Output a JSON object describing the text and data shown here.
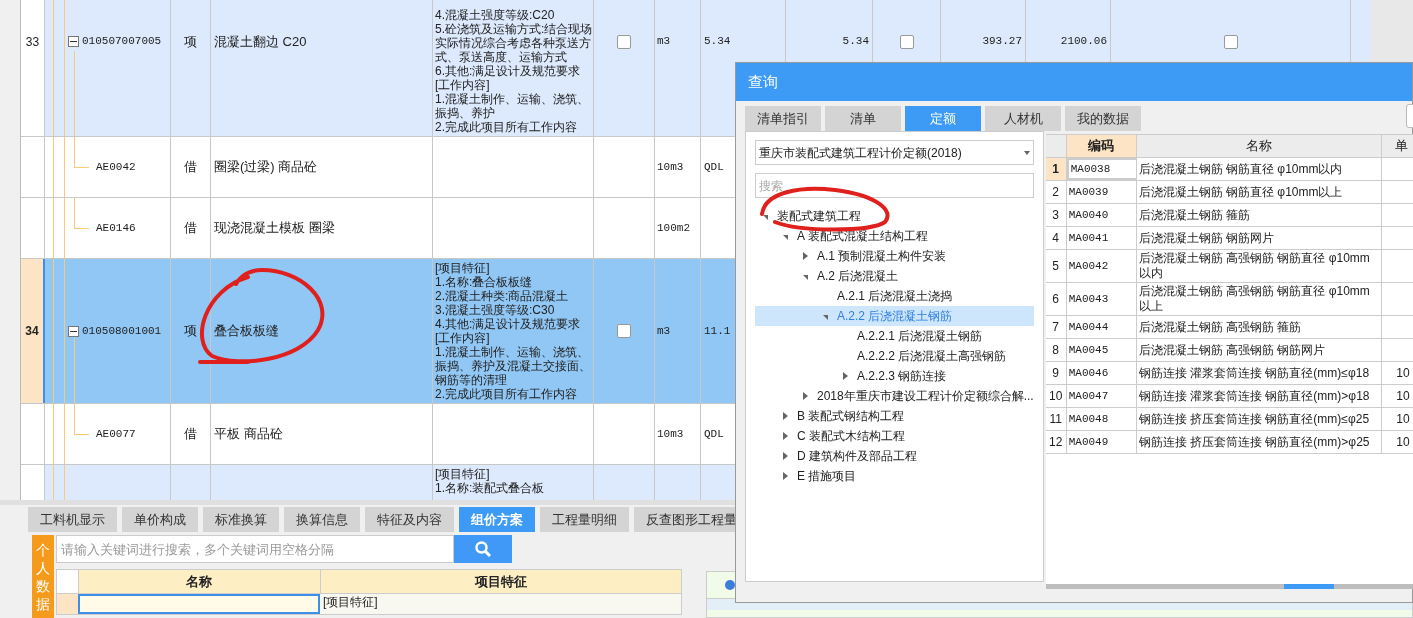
{
  "main_table": {
    "rows": [
      {
        "kind": "item",
        "number": "33",
        "expanded": true,
        "code": "010507007005",
        "type": "项",
        "name": "混凝土翻边 C20",
        "features": [
          "4.混凝土强度等级:C20",
          "5.砼浇筑及运输方式:结合现场实际情况综合考虑各种泵送方式、泵送高度、运输方式",
          "6.其他:满足设计及规范要求",
          "[工作内容]",
          "1.混凝土制作、运输、浇筑、振捣、养护",
          "2.完成此项目所有工作内容"
        ],
        "checked": false,
        "unit": "m3",
        "quantity": "5.34",
        "column_9": "5.34",
        "column_10_checked": false,
        "column_11": "393.27",
        "column_12": "2100.06",
        "column_13_checked": false,
        "selected": false
      },
      {
        "kind": "sub",
        "code": "AE0042",
        "type": "借",
        "name": "圈梁(过梁) 商品砼",
        "unit": "10m3",
        "quantity": "QDL",
        "selected": false
      },
      {
        "kind": "sub",
        "code": "AE0146",
        "type": "借",
        "name": "现浇混凝土模板 圈梁",
        "unit": "100m2",
        "selected": false
      },
      {
        "kind": "item",
        "number": "34",
        "expanded": true,
        "code": "010508001001",
        "type": "项",
        "name": "叠合板板缝",
        "features": [
          "[项目特征]",
          "1.名称:叠合板板缝",
          "2.混凝土种类:商品混凝土",
          "3.混凝土强度等级:C30",
          "4.其他:满足设计及规范要求",
          "[工作内容]",
          "1.混凝土制作、运输、浇筑、振捣、养护及混凝土交接面、钢筋等的清理",
          "2.完成此项目所有工作内容"
        ],
        "checked": false,
        "unit": "m3",
        "quantity": "11.1",
        "selected": true
      },
      {
        "kind": "sub",
        "code": "AE0077",
        "type": "借",
        "name": "平板 商品砼",
        "unit": "10m3",
        "quantity": "QDL",
        "selected": false
      },
      {
        "kind": "item_partial",
        "features": [
          "[项目特征]",
          "1.名称:装配式叠合板"
        ],
        "selected": false
      }
    ]
  },
  "detail_tabs": [
    {
      "label": "工料机显示",
      "selected": false
    },
    {
      "label": "单价构成",
      "selected": false
    },
    {
      "label": "标准换算",
      "selected": false
    },
    {
      "label": "换算信息",
      "selected": false
    },
    {
      "label": "特征及内容",
      "selected": false
    },
    {
      "label": "组价方案",
      "selected": true
    },
    {
      "label": "工程量明细",
      "selected": false
    },
    {
      "label": "反查图形工程量",
      "selected": false
    }
  ],
  "side_tab": "个人数据",
  "plan_search": {
    "placeholder": "请输入关键词进行搜索，多个关键词用空格分隔"
  },
  "plan_table": {
    "columns": [
      "名称",
      "项目特征"
    ],
    "rows": [
      {
        "column_2": "[项目特征]"
      }
    ]
  },
  "dialog": {
    "title": "查询",
    "tabs": [
      {
        "label": "清单指引",
        "selected": false
      },
      {
        "label": "清单",
        "selected": false
      },
      {
        "label": "定额",
        "selected": true
      },
      {
        "label": "人材机",
        "selected": false
      },
      {
        "label": "我的数据",
        "selected": false
      }
    ],
    "library_select": {
      "value": "重庆市装配式建筑工程计价定额(2018)"
    },
    "search": {
      "placeholder": "搜索"
    },
    "tree": [
      {
        "label": "装配式建筑工程",
        "kind": "folder",
        "expanded": true,
        "selected": false,
        "children": [
          {
            "label": "A 装配式混凝土结构工程",
            "kind": "folder",
            "expanded": true,
            "selected": false,
            "children": [
              {
                "label": "A.1 预制混凝土构件安装",
                "kind": "folder",
                "expanded": false,
                "selected": false
              },
              {
                "label": "A.2 后浇混凝土",
                "kind": "folder",
                "expanded": true,
                "selected": false,
                "children": [
                  {
                    "label": "A.2.1 后浇混凝土浇捣",
                    "kind": "leaf",
                    "selected": false
                  },
                  {
                    "label": "A.2.2 后浇混凝土钢筋",
                    "kind": "folder",
                    "expanded": true,
                    "selected": true,
                    "children": [
                      {
                        "label": "A.2.2.1 后浇混凝土钢筋",
                        "kind": "leaf",
                        "selected": false
                      },
                      {
                        "label": "A.2.2.2 后浇混凝土高强钢筋",
                        "kind": "leaf",
                        "selected": false
                      },
                      {
                        "label": "A.2.2.3 钢筋连接",
                        "kind": "folder",
                        "expanded": false,
                        "selected": false
                      }
                    ]
                  }
                ]
              },
              {
                "label": "2018年重庆市建设工程计价定额综合解...",
                "kind": "folder",
                "expanded": false,
                "selected": false
              }
            ]
          },
          {
            "label": "B 装配式钢结构工程",
            "kind": "folder",
            "expanded": false,
            "selected": false
          },
          {
            "label": "C 装配式木结构工程",
            "kind": "folder",
            "expanded": false,
            "selected": false
          },
          {
            "label": "D 建筑构件及部品工程",
            "kind": "folder",
            "expanded": false,
            "selected": false
          },
          {
            "label": "E 措施项目",
            "kind": "folder",
            "expanded": false,
            "selected": false
          }
        ]
      }
    ],
    "table": {
      "columns": [
        "编码",
        "名称",
        "单"
      ],
      "rows": [
        {
          "number": "1",
          "code": "MA0038",
          "name": "后浇混凝土钢筋 钢筋直径 φ10mm以内",
          "selected": true
        },
        {
          "number": "2",
          "code": "MA0039",
          "name": "后浇混凝土钢筋 钢筋直径 φ10mm以上",
          "selected": false
        },
        {
          "number": "3",
          "code": "MA0040",
          "name": "后浇混凝土钢筋 箍筋",
          "selected": false
        },
        {
          "number": "4",
          "code": "MA0041",
          "name": "后浇混凝土钢筋 钢筋网片",
          "selected": false
        },
        {
          "number": "5",
          "code": "MA0042",
          "name": "后浇混凝土钢筋 高强钢筋 钢筋直径 φ10mm以内",
          "selected": false
        },
        {
          "number": "6",
          "code": "MA0043",
          "name": "后浇混凝土钢筋 高强钢筋 钢筋直径 φ10mm以上",
          "selected": false
        },
        {
          "number": "7",
          "code": "MA0044",
          "name": "后浇混凝土钢筋 高强钢筋 箍筋",
          "selected": false
        },
        {
          "number": "8",
          "code": "MA0045",
          "name": "后浇混凝土钢筋 高强钢筋 钢筋网片",
          "selected": false
        },
        {
          "number": "9",
          "code": "MA0046",
          "name": "钢筋连接 灌浆套筒连接 钢筋直径(mm)≤φ18",
          "column_4": "10",
          "selected": false
        },
        {
          "number": "10",
          "code": "MA0047",
          "name": "钢筋连接 灌浆套筒连接 钢筋直径(mm)>φ18",
          "column_4": "10",
          "selected": false
        },
        {
          "number": "11",
          "code": "MA0048",
          "name": "钢筋连接 挤压套筒连接 钢筋直径(mm)≤φ25",
          "column_4": "10",
          "selected": false
        },
        {
          "number": "12",
          "code": "MA0049",
          "name": "钢筋连接 挤压套筒连接 钢筋直径(mm)>φ25",
          "column_4": "10",
          "selected": false
        }
      ]
    }
  }
}
